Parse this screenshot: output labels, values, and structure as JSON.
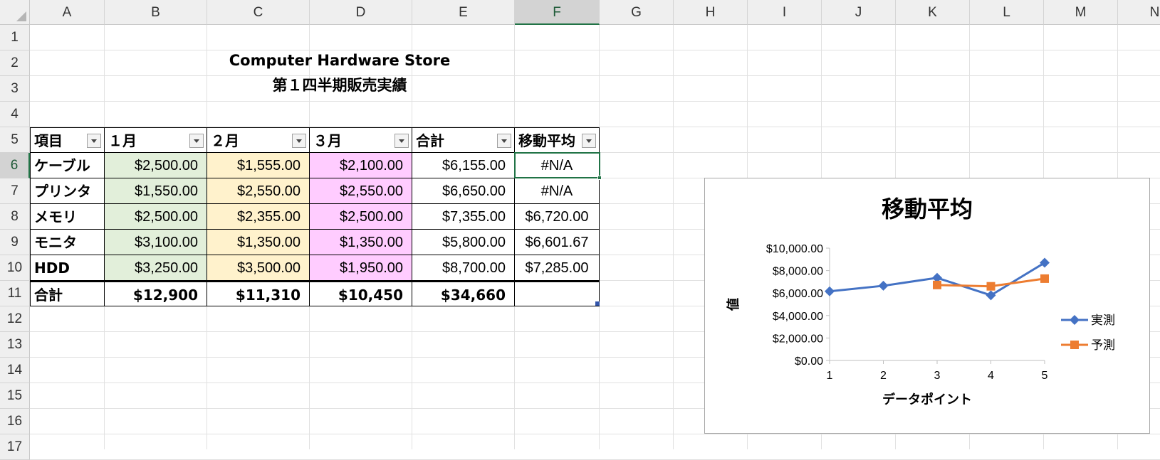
{
  "sheet": {
    "columns": [
      "A",
      "B",
      "C",
      "D",
      "E",
      "F",
      "G",
      "H",
      "I",
      "J",
      "K",
      "L",
      "M",
      "N"
    ],
    "rows": [
      "1",
      "2",
      "3",
      "4",
      "5",
      "6",
      "7",
      "8",
      "9",
      "10",
      "11",
      "12",
      "13",
      "14",
      "15",
      "16",
      "17"
    ],
    "active_column": "F",
    "active_row": "6"
  },
  "titles": {
    "line1": "Computer Hardware Store",
    "line2": "第１四半期販売実績"
  },
  "table": {
    "headers": [
      "項目",
      "１月",
      "２月",
      "３月",
      "合計",
      "移動平均"
    ],
    "rows": [
      {
        "item": "ケーブル",
        "jan": "$2,500.00",
        "feb": "$1,555.00",
        "mar": "$2,100.00",
        "total": "$6,155.00",
        "ma": "#N/A"
      },
      {
        "item": "プリンタ",
        "jan": "$1,550.00",
        "feb": "$2,550.00",
        "mar": "$2,550.00",
        "total": "$6,650.00",
        "ma": "#N/A"
      },
      {
        "item": "メモリ",
        "jan": "$2,500.00",
        "feb": "$2,355.00",
        "mar": "$2,500.00",
        "total": "$7,355.00",
        "ma": "$6,720.00"
      },
      {
        "item": "モニタ",
        "jan": "$3,100.00",
        "feb": "$1,350.00",
        "mar": "$1,350.00",
        "total": "$5,800.00",
        "ma": "$6,601.67"
      },
      {
        "item": "HDD",
        "jan": "$3,250.00",
        "feb": "$3,500.00",
        "mar": "$1,950.00",
        "total": "$8,700.00",
        "ma": "$7,285.00"
      }
    ],
    "totals": {
      "label": "合計",
      "jan": "$12,900",
      "feb": "$11,310",
      "mar": "$10,450",
      "total": "$34,660",
      "ma": ""
    },
    "fill_colors": {
      "jan": "#e2efda",
      "feb": "#fff2cc",
      "mar": "#ffccff"
    }
  },
  "chart_data": {
    "type": "line",
    "title": "移動平均",
    "xlabel": "データポイント",
    "ylabel": "値",
    "x": [
      1,
      2,
      3,
      4,
      5
    ],
    "x_tick_labels": [
      "1",
      "2",
      "3",
      "4",
      "5"
    ],
    "y_tick_labels": [
      "$0.00",
      "$2,000.00",
      "$4,000.00",
      "$6,000.00",
      "$8,000.00",
      "$10,000.00"
    ],
    "ylim": [
      0,
      10000
    ],
    "legend_position": "right",
    "series": [
      {
        "name": "実測",
        "x": [
          1,
          2,
          3,
          4,
          5
        ],
        "values": [
          6155,
          6650,
          7355,
          5800,
          8700
        ],
        "color": "#4472c4",
        "marker": "diamond"
      },
      {
        "name": "予測",
        "x": [
          3,
          4,
          5
        ],
        "values": [
          6720,
          6601.67,
          7285
        ],
        "color": "#ed7d31",
        "marker": "square"
      }
    ]
  }
}
